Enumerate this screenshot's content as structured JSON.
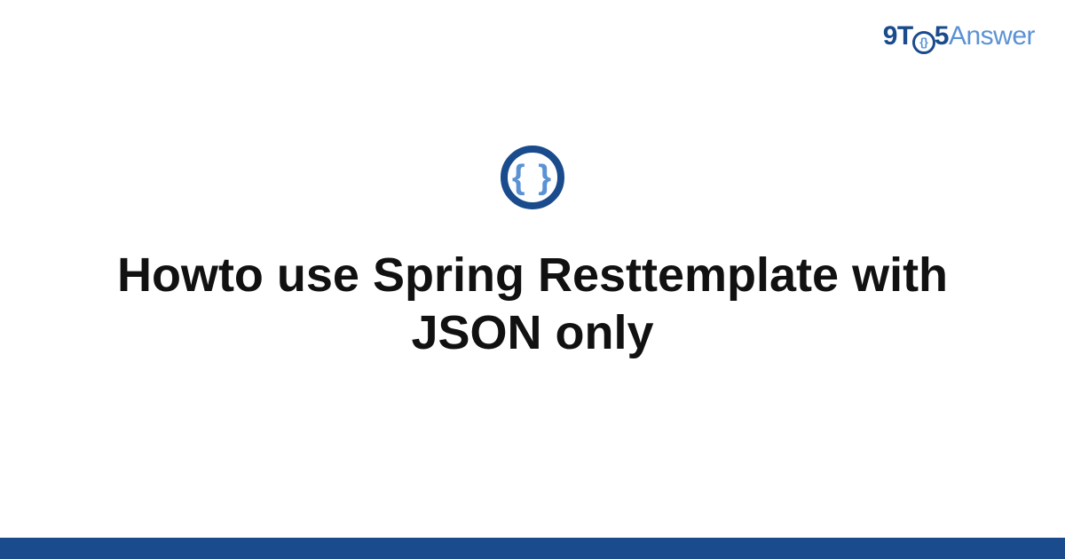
{
  "logo": {
    "part1": "9T",
    "circleText": "{}",
    "part2": "5",
    "part3": "Answer"
  },
  "iconGlyph": "{ }",
  "title": "Howto use Spring Resttemplate with JSON only",
  "colors": {
    "primary": "#1a4b8c",
    "accent": "#5a92d4"
  }
}
